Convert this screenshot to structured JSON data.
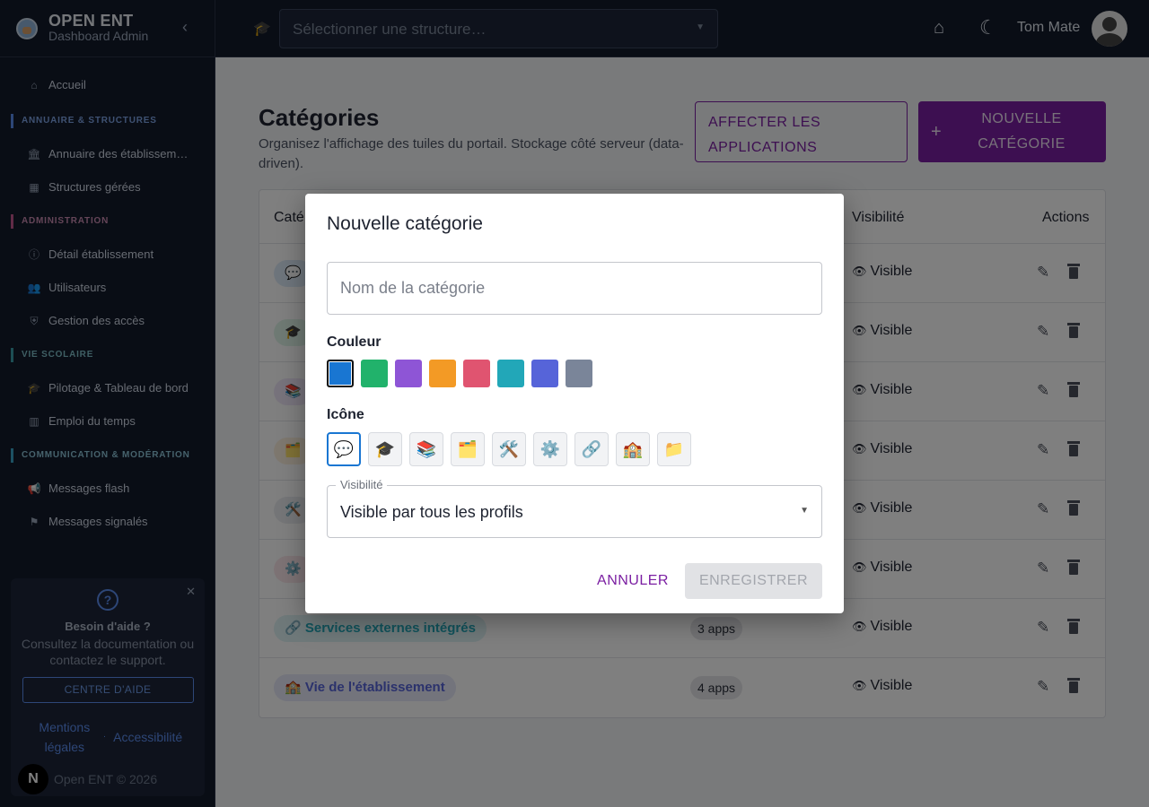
{
  "brand": {
    "title": "OPEN ENT",
    "subtitle": "Dashboard Admin"
  },
  "sidebar": {
    "home": {
      "label": "Accueil"
    },
    "sections": [
      {
        "title": "ANNUAIRE & STRUCTURES",
        "items": [
          "Annuaire des établissem…",
          "Structures gérées"
        ]
      },
      {
        "title": "ADMINISTRATION",
        "items": [
          "Détail établissement",
          "Utilisateurs",
          "Gestion des accès"
        ]
      },
      {
        "title": "VIE SCOLAIRE",
        "items": [
          "Pilotage & Tableau de bord",
          "Emploi du temps"
        ]
      },
      {
        "title": "COMMUNICATION & MODÉRATION",
        "items": [
          "Messages flash",
          "Messages signalés"
        ]
      }
    ],
    "help": {
      "title": "Besoin d'aide ?",
      "text": "Consultez la documentation ou contactez le support.",
      "button": "CENTRE D'AIDE"
    },
    "legal": {
      "mentions": "Mentions légales",
      "separator": "·",
      "accessibility": "Accessibilité"
    },
    "copyright": "Open ENT © 2026",
    "n_logo": "N"
  },
  "topbar": {
    "structure_placeholder": "Sélectionner une structure…",
    "user_name": "Tom Mate"
  },
  "page": {
    "title": "Catégories",
    "description": "Organisez l'affichage des tuiles du portail. Stockage côté serveur (data-driven).",
    "assign_button": "AFFECTER LES APPLICATIONS",
    "new_button": "NOUVELLE CATÉGORIE",
    "new_button_icon": "+"
  },
  "table": {
    "headers": {
      "category": "Caté",
      "visibility": "Visibilité",
      "actions": "Actions"
    },
    "rows": [
      {
        "icon": "💬",
        "label": "",
        "apps": "",
        "visibility": "Visible",
        "color": "#1976d2"
      },
      {
        "icon": "🎓",
        "label": "",
        "apps": "",
        "visibility": "Visible",
        "color": "#21b26b"
      },
      {
        "icon": "📚",
        "label": "",
        "apps": "",
        "visibility": "Visible",
        "color": "#8e55d6"
      },
      {
        "icon": "🗂️",
        "label": "",
        "apps": "",
        "visibility": "Visible",
        "color": "#f39a25"
      },
      {
        "icon": "🛠️",
        "label": "",
        "apps": "",
        "visibility": "Visible",
        "color": "#7a8599"
      },
      {
        "icon": "⚙️",
        "label": "",
        "apps": "",
        "visibility": "Visible",
        "color": "#e05470"
      },
      {
        "icon": "🔗",
        "label": "Services externes intégrés",
        "apps": "3 apps",
        "visibility": "Visible",
        "color": "#22a7b8"
      },
      {
        "icon": "🏫",
        "label": "Vie de l'établissement",
        "apps": "4 apps",
        "visibility": "Visible",
        "color": "#5664d9"
      }
    ]
  },
  "dialog": {
    "title": "Nouvelle catégorie",
    "name_placeholder": "Nom de la catégorie",
    "name_value": "",
    "color_label": "Couleur",
    "colors": [
      "#1976d2",
      "#21b26b",
      "#8e55d6",
      "#f39a25",
      "#e05470",
      "#22a7b8",
      "#5664d9",
      "#7a8599"
    ],
    "selected_color": "#1976d2",
    "icon_label": "Icône",
    "icons": [
      "💬",
      "🎓",
      "📚",
      "🗂️",
      "🛠️",
      "⚙️",
      "🔗",
      "🏫",
      "📁"
    ],
    "selected_icon": "💬",
    "visibility_label": "Visibilité",
    "visibility_value": "Visible par tous les profils",
    "cancel": "ANNULER",
    "save": "ENREGISTRER"
  }
}
